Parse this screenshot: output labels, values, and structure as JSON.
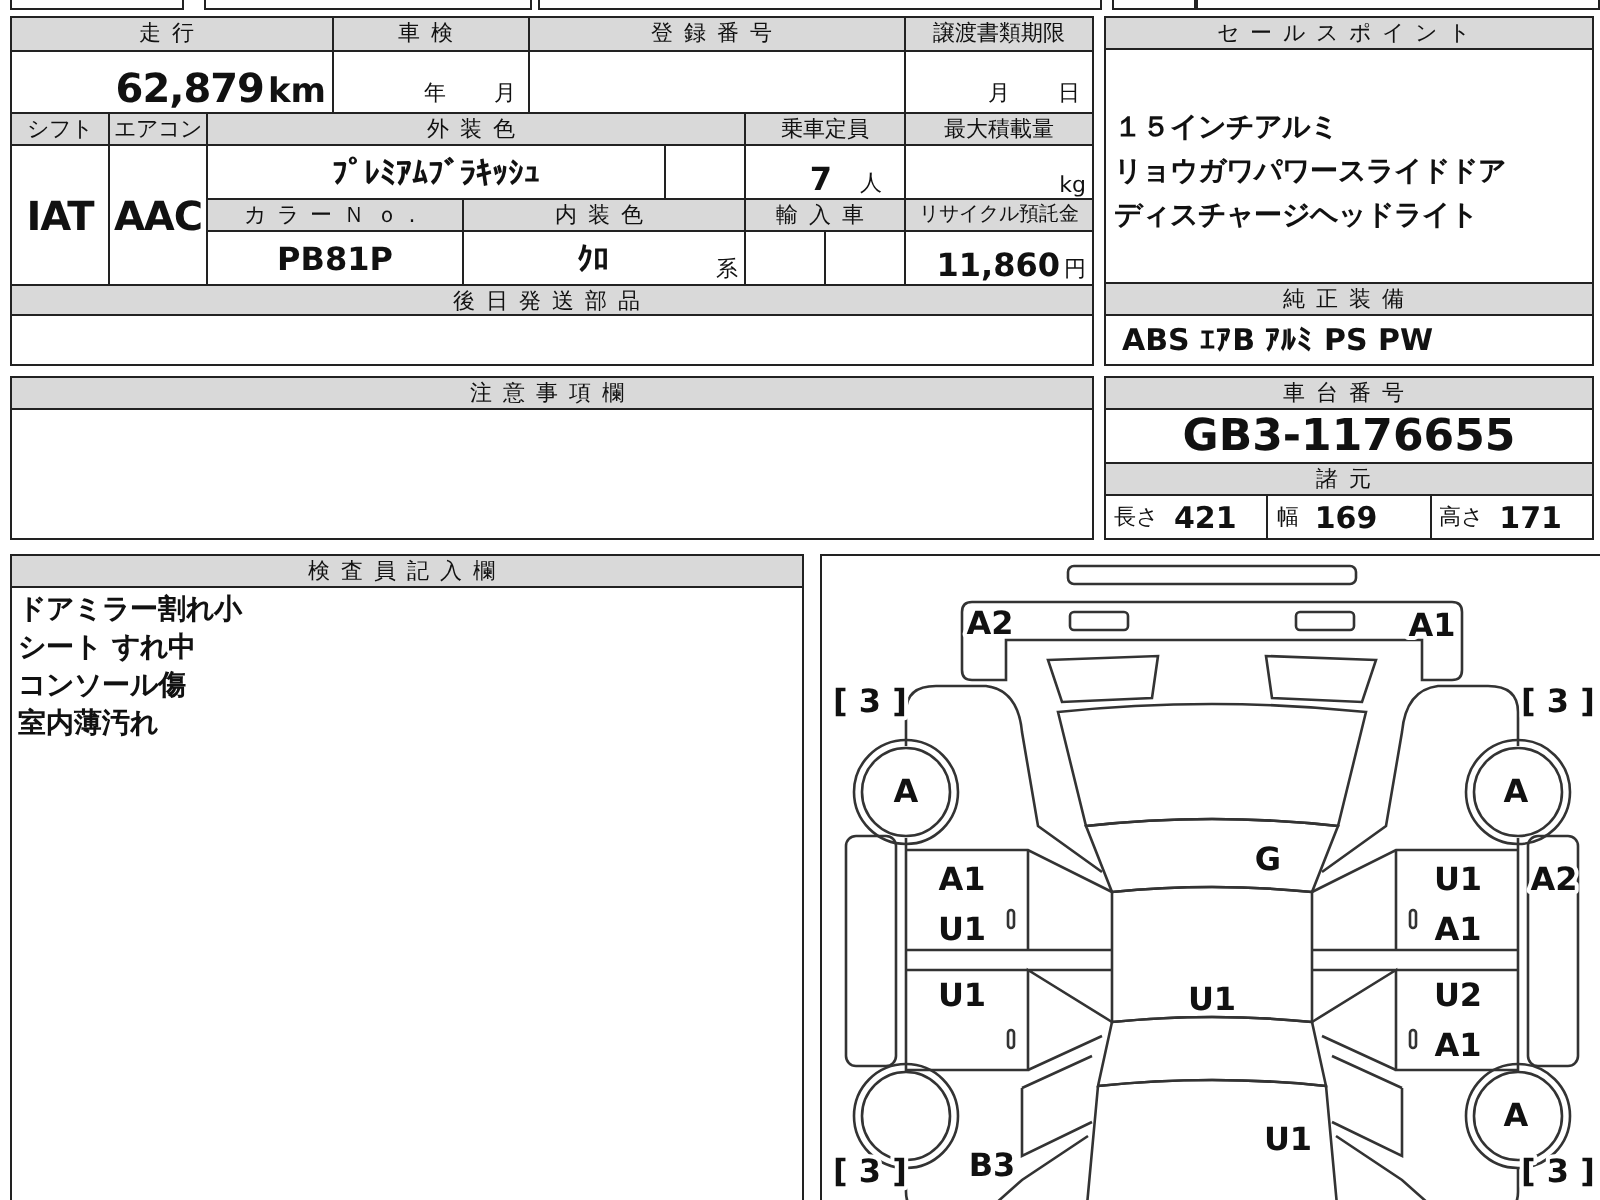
{
  "vehicle_table": {
    "mileage": {
      "label": "走行",
      "value": "62,879",
      "unit": "km"
    },
    "inspection": {
      "label": "車検",
      "year_unit": "年",
      "month_unit": "月"
    },
    "registration_number": {
      "label": "登録番号"
    },
    "transfer_deadline": {
      "label": "譲渡書類期限",
      "month_unit": "月",
      "day_unit": "日"
    },
    "shift": {
      "label": "シフト",
      "value": "IAT"
    },
    "air_conditioner": {
      "label": "エアコン",
      "value": "AAC"
    },
    "exterior_color": {
      "label": "外装色",
      "value": "ﾌﾟﾚﾐｱﾑﾌﾞﾗｷｯｼｭ"
    },
    "capacity": {
      "label": "乗車定員",
      "value": "7",
      "unit": "人"
    },
    "max_load": {
      "label": "最大積載量",
      "unit": "kg"
    },
    "color_number": {
      "label": "カラーＮｏ.",
      "value": "PB81P"
    },
    "interior_color": {
      "label": "内装色",
      "value": "ｸﾛ",
      "suffix": "系"
    },
    "imported": {
      "label": "輸入車"
    },
    "recycle_fee": {
      "label": "リサイクル預託金",
      "value": "11,860",
      "unit": "円"
    },
    "later_parts": {
      "label": "後日発送部品"
    }
  },
  "sales_points": {
    "label": "セールスポイント",
    "lines": [
      "１５インチアルミ",
      "リョウガワパワースライドドア",
      "ディスチャージヘッドライト"
    ]
  },
  "standard_equipment": {
    "label": "純正装備",
    "value": "ABS ｴｱB ｱﾙﾐ PS PW"
  },
  "notes": {
    "label": "注意事項欄"
  },
  "chassis": {
    "label": "車台番号",
    "value": "GB3-1176655"
  },
  "specs": {
    "label": "諸元",
    "items": [
      {
        "label": "長さ",
        "value": "421"
      },
      {
        "label": "幅",
        "value": "169"
      },
      {
        "label": "高さ",
        "value": "171"
      }
    ]
  },
  "inspector_notes": {
    "label": "検査員記入欄",
    "lines": [
      "ドアミラー割れ小",
      "シート すれ中",
      "コンソール傷",
      "室内薄汚れ"
    ]
  },
  "damage_marks": [
    "A2",
    "A1",
    "[ 3 ]",
    "[ 3 ]",
    "A",
    "A",
    "G",
    "A1",
    "U1",
    "A2",
    "U1",
    "A1",
    "U1",
    "U1",
    "U2",
    "A1",
    "A",
    "U1",
    "[ 3 ]",
    "B3",
    "[ 3 ]"
  ]
}
